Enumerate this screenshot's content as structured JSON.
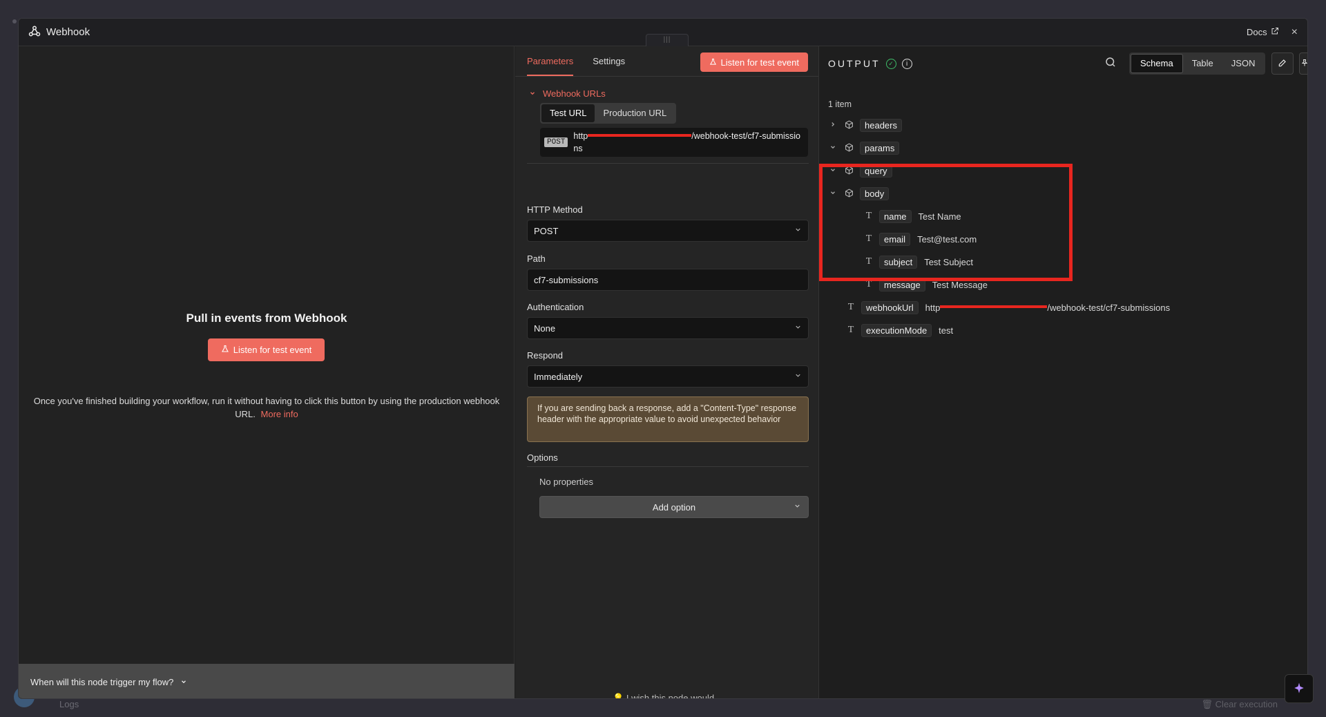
{
  "modal": {
    "title": "Webhook",
    "docs_label": "Docs",
    "close": "×"
  },
  "left": {
    "heading": "Pull in events from Webhook",
    "listen_button": "Listen for test event",
    "description": "Once you've finished building your workflow, run it without having to click this button by using the production webhook URL.",
    "more_info": "More info",
    "footer_question": "When will this node trigger my flow?"
  },
  "middle": {
    "tabs": [
      "Parameters",
      "Settings"
    ],
    "listen_button": "Listen for test event",
    "section_title": "Webhook URLs",
    "url_tabs": [
      "Test URL",
      "Production URL"
    ],
    "url_method": "POST",
    "url_prefix": "http",
    "url_suffix": "/webhook-test/cf7-submissions",
    "http_method_label": "HTTP Method",
    "http_method_value": "POST",
    "path_label": "Path",
    "path_value": "cf7-submissions",
    "auth_label": "Authentication",
    "auth_value": "None",
    "respond_label": "Respond",
    "respond_value": "Immediately",
    "notice": "If you are sending back a response, add a \"Content-Type\" response header with the appropriate value to avoid unexpected behavior",
    "options_label": "Options",
    "no_properties": "No properties",
    "add_option": "Add option",
    "wish": "I wish this node would..."
  },
  "output": {
    "title": "OUTPUT",
    "view_tabs": [
      "Schema",
      "Table",
      "JSON"
    ],
    "item_count": "1 item",
    "tree": {
      "headers": "headers",
      "params": "params",
      "query": "query",
      "body": "body",
      "body_fields": [
        {
          "key": "name",
          "value": "Test Name"
        },
        {
          "key": "email",
          "value": "Test@test.com"
        },
        {
          "key": "subject",
          "value": "Test Subject"
        },
        {
          "key": "message",
          "value": "Test Message"
        }
      ],
      "webhookUrl_key": "webhookUrl",
      "webhookUrl_prefix": "http",
      "webhookUrl_suffix": "/webhook-test/cf7-submissions",
      "executionMode_key": "executionMode",
      "executionMode_value": "test"
    }
  },
  "background": {
    "logs": "Logs",
    "clear_execution": "Clear execution"
  },
  "colors": {
    "accent": "#ef6b5f",
    "highlight": "#e8261f",
    "success": "#3fbf6a"
  }
}
